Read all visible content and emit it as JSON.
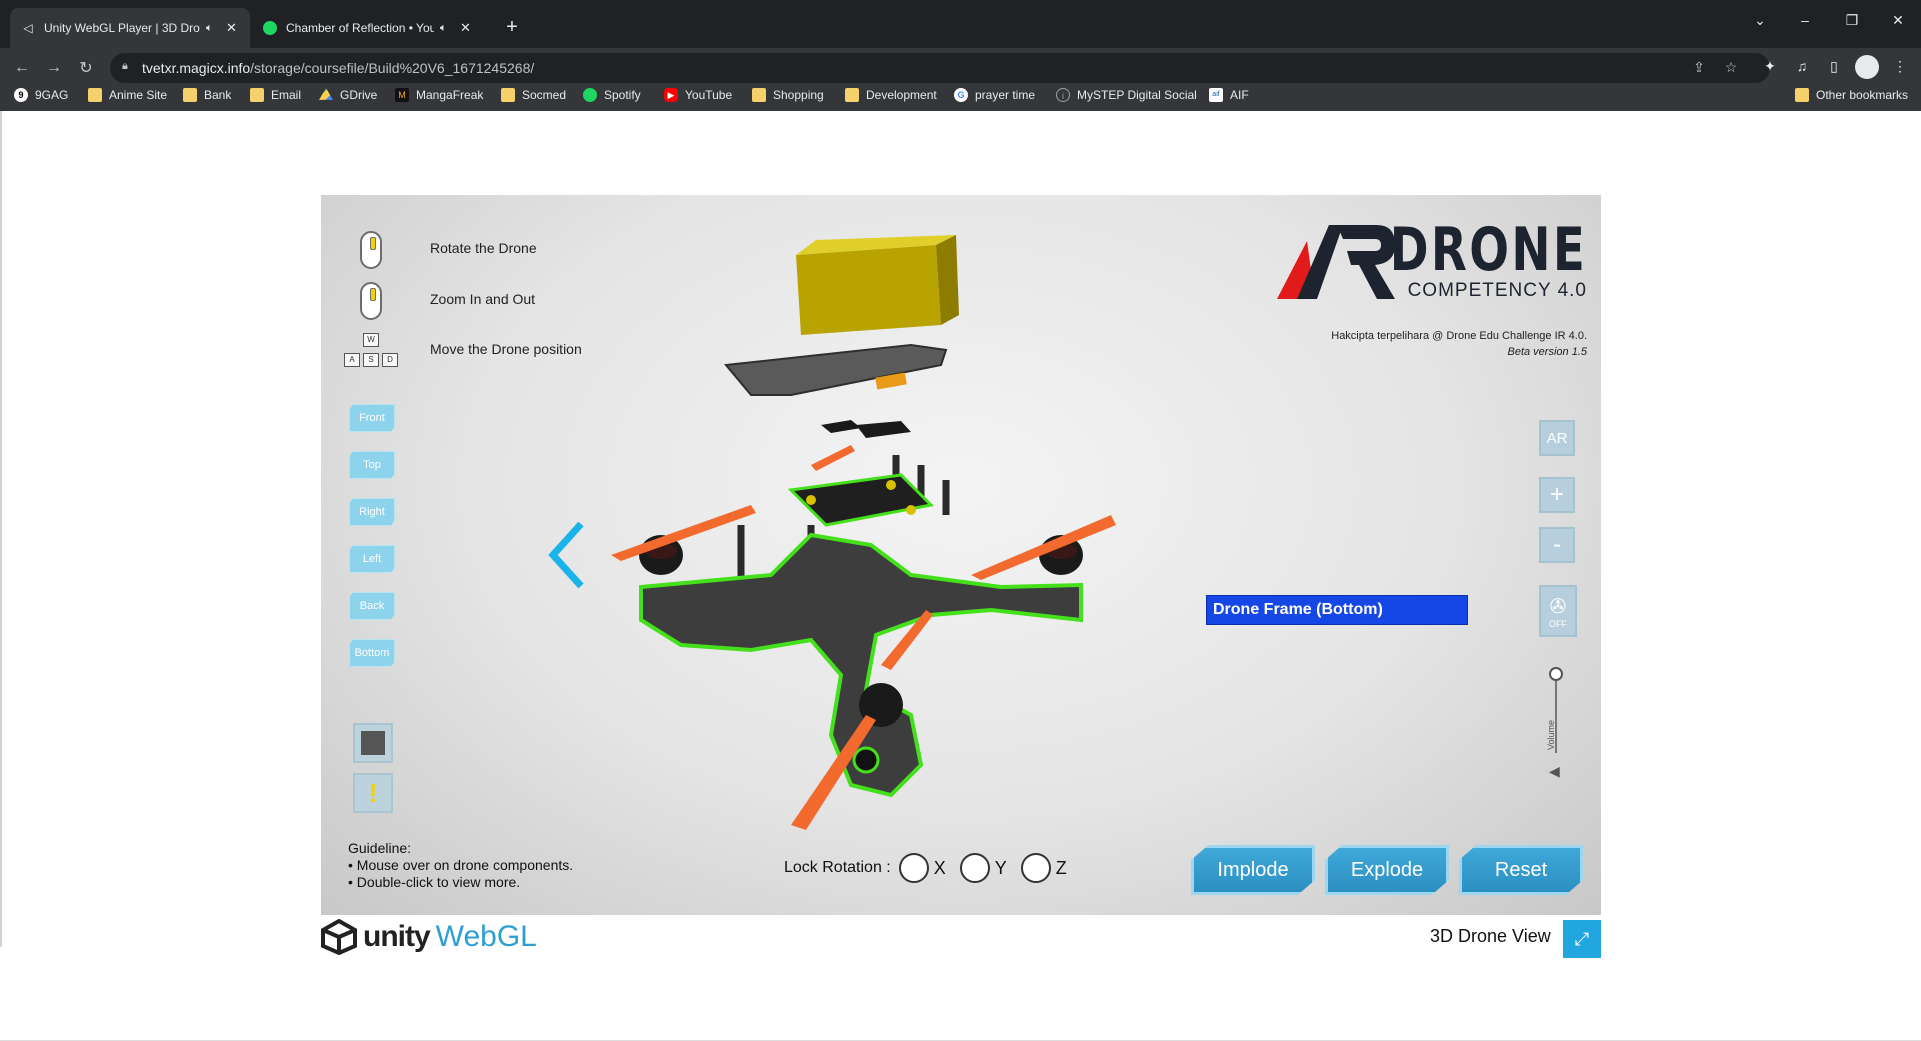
{
  "browser": {
    "tabs": [
      {
        "title": "Unity WebGL Player | 3D Dro",
        "active": true,
        "icon": "unity-icon"
      },
      {
        "title": "Chamber of Reflection • Your",
        "active": false,
        "icon": "spotify-icon"
      }
    ],
    "url_host": "tvetxr.magicx.info",
    "url_path": "/storage/coursefile/Build%20V6_1671245268/",
    "bookmarks": [
      {
        "label": "9GAG",
        "icon": "9gag-icon"
      },
      {
        "label": "Anime Site",
        "icon": "folder-icon"
      },
      {
        "label": "Bank",
        "icon": "folder-icon"
      },
      {
        "label": "Email",
        "icon": "folder-icon"
      },
      {
        "label": "GDrive",
        "icon": "gdrive-icon"
      },
      {
        "label": "MangaFreak",
        "icon": "mangafreak-icon"
      },
      {
        "label": "Socmed",
        "icon": "folder-icon"
      },
      {
        "label": "Spotify",
        "icon": "spotify-icon"
      },
      {
        "label": "YouTube",
        "icon": "youtube-icon"
      },
      {
        "label": "Shopping",
        "icon": "folder-icon"
      },
      {
        "label": "Development",
        "icon": "folder-icon"
      },
      {
        "label": "prayer time",
        "icon": "google-icon"
      },
      {
        "label": "MySTEP Digital Social",
        "icon": "mystep-icon"
      },
      {
        "label": "AIF",
        "icon": "aif-icon"
      }
    ],
    "other_bookmarks": "Other bookmarks"
  },
  "app": {
    "controls": [
      {
        "label": "Rotate the Drone"
      },
      {
        "label": "Zoom In and Out"
      },
      {
        "label": "Move the Drone position"
      }
    ],
    "wasd": [
      "W",
      "A",
      "S",
      "D"
    ],
    "views": [
      "Front",
      "Top",
      "Right",
      "Left",
      "Back",
      "Bottom"
    ],
    "logo": {
      "ar": "AR",
      "drone": "DRONE",
      "competency": "COMPETENCY 4.0",
      "copyright": "Hakcipta terpelihara @ Drone Edu Challenge IR 4.0.",
      "beta": "Beta version 1.5"
    },
    "right_buttons": {
      "ar": "AR",
      "plus": "+",
      "minus": "-",
      "fan_off": "OFF"
    },
    "volume_label": "Volume",
    "volume_level": 1.0,
    "tooltip": "Drone Frame (Bottom)",
    "guideline": {
      "title": "Guideline:",
      "items": [
        "• Mouse over on drone components.",
        "• Double-click to view more."
      ]
    },
    "lock_rotation": {
      "label": "Lock Rotation :",
      "axes": [
        "X",
        "Y",
        "Z"
      ]
    },
    "actions": {
      "implode": "Implode",
      "explode": "Explode",
      "reset": "Reset"
    }
  },
  "footer": {
    "unity": "unity",
    "webgl": "WebGL",
    "title": "3D Drone View"
  },
  "colors": {
    "accent_blue": "#21a6e0",
    "tooltip_blue": "#1546e6",
    "highlight_green": "#44e01c",
    "propeller_orange": "#f26a2e",
    "battery_yellow": "#d9c100"
  }
}
